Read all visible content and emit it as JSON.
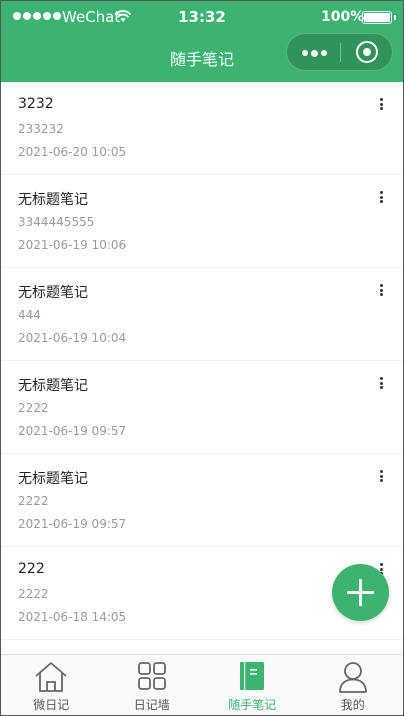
{
  "status_bar": {
    "carrier": "WeChat",
    "time": "13:32",
    "battery": "100%",
    "battery_level": 1.0
  },
  "nav": {
    "title": "随手笔记"
  },
  "notes": [
    {
      "title": "3232",
      "body": "233232",
      "date": "2021-06-20 10:05"
    },
    {
      "title": "无标题笔记",
      "body": "3344445555",
      "date": "2021-06-19 10:06"
    },
    {
      "title": "无标题笔记",
      "body": "444",
      "date": "2021-06-19 10:04"
    },
    {
      "title": "无标题笔记",
      "body": "2222",
      "date": "2021-06-19 09:57"
    },
    {
      "title": "无标题笔记",
      "body": "2222",
      "date": "2021-06-19 09:57"
    },
    {
      "title": "222",
      "body": "2222",
      "date": "2021-06-18 14:05"
    }
  ],
  "tabbar": {
    "items": [
      {
        "label": "微日记",
        "icon": "home-icon"
      },
      {
        "label": "日记墙",
        "icon": "grid-icon"
      },
      {
        "label": "随手笔记",
        "icon": "notebook-icon",
        "active": true
      },
      {
        "label": "我的",
        "icon": "user-icon"
      }
    ]
  },
  "colors": {
    "brand": "#3cb371",
    "text": "#222222",
    "muted": "#9a9a9a"
  }
}
